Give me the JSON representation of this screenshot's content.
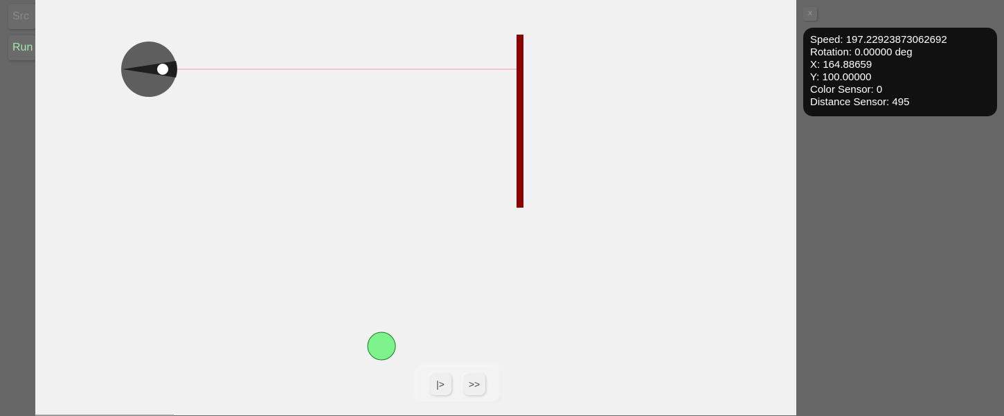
{
  "sidebar": {
    "src_label": "Src",
    "run_label": "Run"
  },
  "controls": {
    "step_label": "|>",
    "fast_forward_label": ">>"
  },
  "panel": {
    "close_label": "x",
    "speed": "Speed: 197.22923873062692",
    "rotation": "Rotation: 0.00000 deg",
    "x": "X: 164.88659",
    "y": "Y: 100.00000",
    "color_sensor": "Color Sensor: 0",
    "distance_sensor": "Distance Sensor: 495"
  },
  "colors": {
    "arena_background": "#f1f1f1",
    "robot_body": "#5e5e5e",
    "robot_sensor_cone": "#1e1e1e",
    "laser": "#f6c3ca",
    "wall": "#8b0000",
    "goal": "#7ef28b"
  }
}
